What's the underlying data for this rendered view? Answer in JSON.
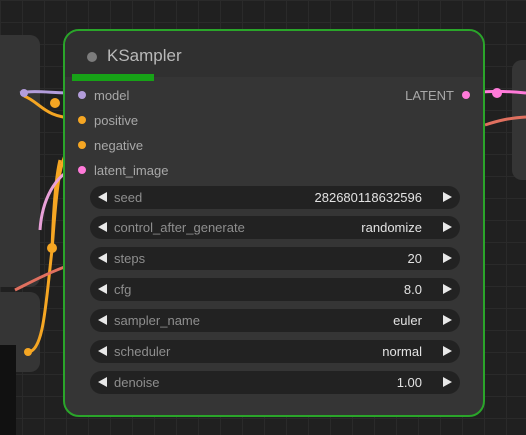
{
  "node": {
    "title": "KSampler",
    "inputs": [
      {
        "label": "model",
        "color": "#b39ddb"
      },
      {
        "label": "positive",
        "color": "#f5a623"
      },
      {
        "label": "negative",
        "color": "#f5a623"
      },
      {
        "label": "latent_image",
        "color": "#ff7ad9"
      }
    ],
    "output": {
      "label": "LATENT",
      "color": "#ff7ad9"
    },
    "widgets": [
      {
        "label": "seed",
        "value": "282680118632596"
      },
      {
        "label": "control_after_generate",
        "value": "randomize"
      },
      {
        "label": "steps",
        "value": "20"
      },
      {
        "label": "cfg",
        "value": "8.0"
      },
      {
        "label": "sampler_name",
        "value": "euler"
      },
      {
        "label": "scheduler",
        "value": "normal"
      },
      {
        "label": "denoise",
        "value": "1.00"
      }
    ]
  },
  "colors": {
    "accent_border": "#2aa52a",
    "progress": "#17a217",
    "wire_model": "#b39ddb",
    "wire_conditioning": "#f5a623",
    "wire_latent": "#ff7ad9",
    "wire_image": "#e0705f"
  }
}
